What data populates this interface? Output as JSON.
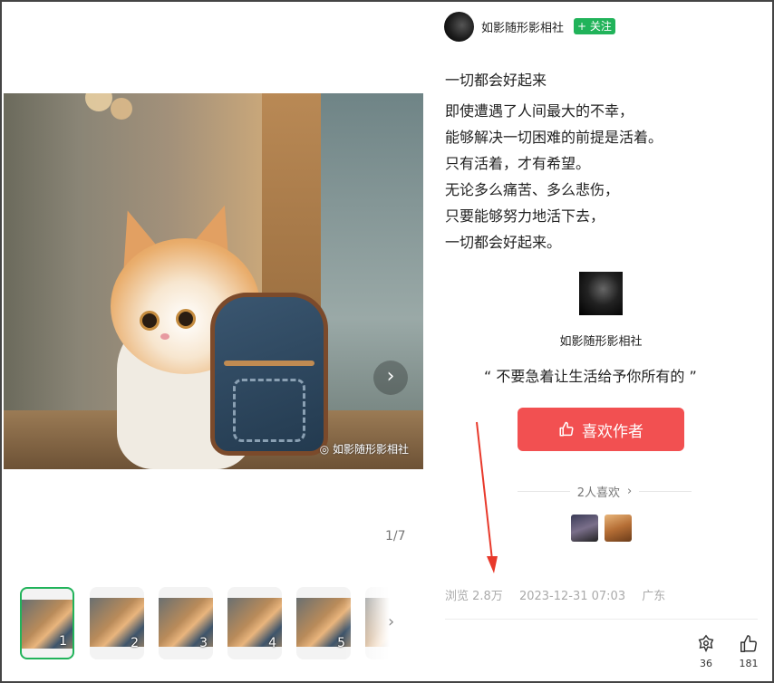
{
  "author": {
    "name": "如影随形影相社",
    "follow_label": "+ 关注"
  },
  "post": {
    "title": "一切都会好起来",
    "lines": [
      "即使遭遇了人间最大的不幸，",
      "能够解决一切困难的前提是活着。",
      "只有活着，才有希望。",
      "无论多么痛苦、多么悲伤，",
      "只要能够努力地活下去，",
      "一切都会好起来。"
    ]
  },
  "gallery": {
    "counter": "1/7",
    "watermark": "如影随形影相社",
    "thumbnails": [
      "1",
      "2",
      "3",
      "4",
      "5"
    ]
  },
  "card": {
    "name": "如影随形影相社",
    "quote": "“  不要急着让生活给予你所有的  ”",
    "like_author_label": "喜欢作者",
    "likes_text": "2人喜欢",
    "likes_chevron": "›"
  },
  "meta": {
    "views": "浏览 2.8万",
    "datetime": "2023-12-31 07:03",
    "location": "广东"
  },
  "actions": {
    "share_count": "36",
    "like_count": "181"
  },
  "annotation": {
    "color": "#e8392b"
  },
  "icons": [
    "chevron-right-icon",
    "wechat-icon",
    "thumbs-up-icon",
    "share-icon"
  ]
}
